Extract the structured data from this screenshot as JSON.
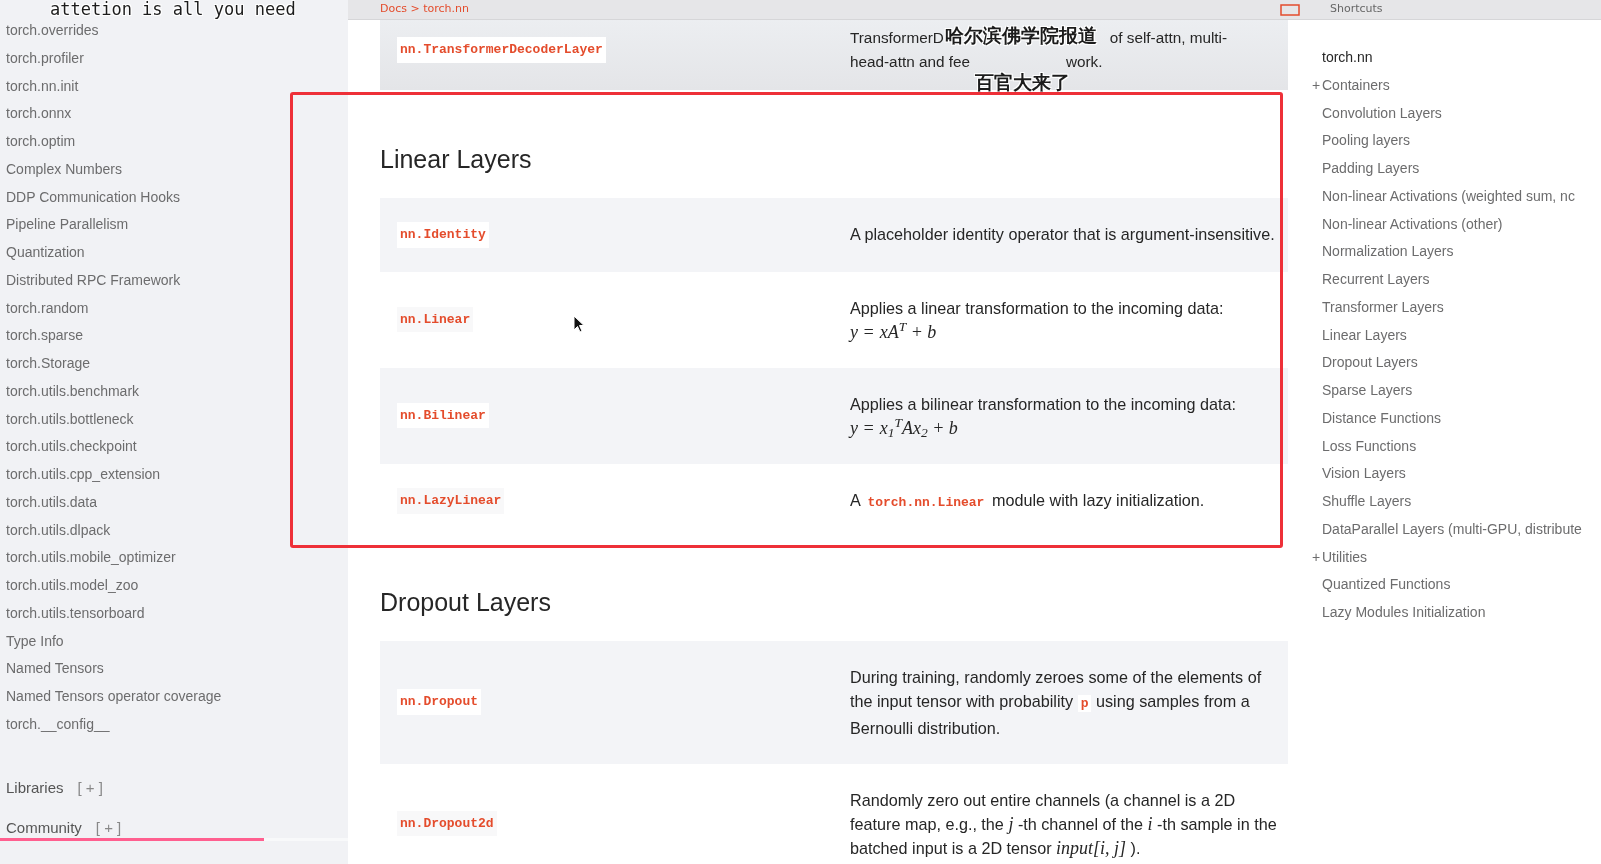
{
  "captions": {
    "top": "attetion is all you need",
    "middle": [
      "哈尔滨佛学院报道",
      "百官大来了"
    ]
  },
  "topbar": {
    "breadcrumb": "Docs > torch.nn",
    "shortcuts": "Shortcuts"
  },
  "sidebar": {
    "items": [
      "torch.overrides",
      "torch.profiler",
      "torch.nn.init",
      "torch.onnx",
      "torch.optim",
      "Complex Numbers",
      "DDP Communication Hooks",
      "Pipeline Parallelism",
      "Quantization",
      "Distributed RPC Framework",
      "torch.random",
      "torch.sparse",
      "torch.Storage",
      "torch.utils.benchmark",
      "torch.utils.bottleneck",
      "torch.utils.checkpoint",
      "torch.utils.cpp_extension",
      "torch.utils.data",
      "torch.utils.dlpack",
      "torch.utils.mobile_optimizer",
      "torch.utils.model_zoo",
      "torch.utils.tensorboard",
      "Type Info",
      "Named Tensors",
      "Named Tensors operator coverage",
      "torch.__config__"
    ],
    "groups": [
      {
        "label": "Libraries",
        "toggle": "[ + ]"
      },
      {
        "label": "Community",
        "toggle": "[ + ]"
      }
    ]
  },
  "top_row": {
    "name": "nn.TransformerDecoderLayer",
    "lines": [
      [
        "TransformerD",
        "of self-attn, multi-"
      ],
      [
        "head-attn and fee",
        "work."
      ]
    ]
  },
  "sections": [
    {
      "title": "Linear Layers",
      "rows": [
        {
          "name": "nn.Identity",
          "description": [
            {
              "kind": "text",
              "text": "A placeholder identity operator that is argument-insensitive."
            }
          ]
        },
        {
          "name": "nn.Linear",
          "description": [
            {
              "kind": "text",
              "text": "Applies a linear transformation to the incoming data: "
            },
            {
              "kind": "math",
              "text": "y ="
            },
            {
              "kind": "math",
              "text": "xA$^{T}$ + b"
            }
          ]
        },
        {
          "name": "nn.Bilinear",
          "description": [
            {
              "kind": "text",
              "text": "Applies a bilinear transformation to the incoming data: "
            },
            {
              "kind": "math",
              "text": "y ="
            },
            {
              "kind": "math",
              "text": "x$_{1}$$^{T}$Ax$_{2}$ + b"
            }
          ]
        },
        {
          "name": "nn.LazyLinear",
          "description": [
            {
              "kind": "text",
              "text": "A "
            },
            {
              "kind": "code",
              "text": "torch.nn.Linear"
            },
            {
              "kind": "text",
              "text": " module with lazy initialization."
            }
          ]
        }
      ]
    },
    {
      "title": "Dropout Layers",
      "rows": [
        {
          "name": "nn.Dropout",
          "description": [
            {
              "kind": "text",
              "text": "During training, randomly zeroes some of the elements of the input tensor with probability "
            },
            {
              "kind": "code",
              "text": "p"
            },
            {
              "kind": "text",
              "text": " using samples from a Bernoulli distribution."
            }
          ]
        },
        {
          "name": "nn.Dropout2d",
          "description": [
            {
              "kind": "text",
              "text": "Randomly zero out entire channels (a channel is a 2D feature map, e.g., the "
            },
            {
              "kind": "math",
              "text": "j"
            },
            {
              "kind": "text",
              "text": " -th channel of the "
            },
            {
              "kind": "math",
              "text": "i"
            },
            {
              "kind": "text",
              "text": " -th sample in the batched input is a 2D tensor "
            },
            {
              "kind": "math",
              "text": "input[i, j]"
            },
            {
              "kind": "text",
              "text": " )."
            }
          ]
        }
      ]
    }
  ],
  "toc": [
    {
      "label": "torch.nn",
      "current": true
    },
    {
      "label": "Containers",
      "toggle": "+"
    },
    {
      "label": "Convolution Layers"
    },
    {
      "label": "Pooling layers"
    },
    {
      "label": "Padding Layers"
    },
    {
      "label": "Non-linear Activations (weighted sum, nc"
    },
    {
      "label": "Non-linear Activations (other)"
    },
    {
      "label": "Normalization Layers"
    },
    {
      "label": "Recurrent Layers"
    },
    {
      "label": "Transformer Layers"
    },
    {
      "label": "Linear Layers"
    },
    {
      "label": "Dropout Layers"
    },
    {
      "label": "Sparse Layers"
    },
    {
      "label": "Distance Functions"
    },
    {
      "label": "Loss Functions"
    },
    {
      "label": "Vision Layers"
    },
    {
      "label": "Shuffle Layers"
    },
    {
      "label": "DataParallel Layers (multi-GPU, distribute"
    },
    {
      "label": "Utilities",
      "toggle": "+"
    },
    {
      "label": "Quantized Functions"
    },
    {
      "label": "Lazy Modules Initialization"
    }
  ],
  "video_progress": {
    "level": 0.76
  }
}
